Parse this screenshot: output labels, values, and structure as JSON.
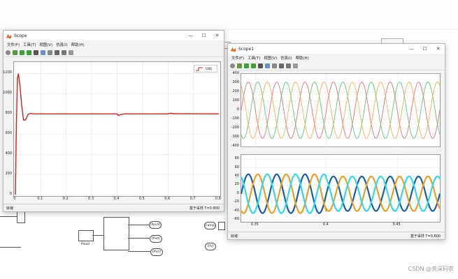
{
  "scope1": {
    "title": "Scope",
    "menu": [
      "文件(F)",
      "工具(T)",
      "视图(V)",
      "仿真(I)",
      "帮助(H)"
    ],
    "status_left": "就绪",
    "status_right": "基于采样  T=0.800",
    "legend": "Udc"
  },
  "scope2": {
    "title": "Scope1",
    "menu": [
      "文件(F)",
      "工具(T)",
      "视图(V)",
      "仿真(I)",
      "帮助(H)"
    ],
    "status_left": "就绪",
    "status_right": "基于采样  T=0.800"
  },
  "window_controls": {
    "minimize": "—",
    "maximize": "☐",
    "close": "✕"
  },
  "model_labels": {
    "pload": "Pload",
    "ppvd": "[Ppvd]",
    "pvd": "[Pvd]",
    "pvd2": "[Pvd]",
    "ramp": "[ramp]",
    "pva": "[Pva]",
    "pv": "[Pv]"
  },
  "watermark": "CSDN @资深码农",
  "chart_data": [
    {
      "type": "line",
      "title": "",
      "xlabel": "",
      "ylabel": "",
      "xlim": [
        0,
        0.8
      ],
      "ylim": [
        0,
        1300
      ],
      "xticks": [
        "0",
        "0.1",
        "0.2",
        "0.3",
        "0.4",
        "0.5",
        "0.6",
        "0.7",
        "0.8"
      ],
      "yticks": [
        "0",
        "200",
        "400",
        "600",
        "800",
        "1000",
        "1200"
      ],
      "legend_position": "top-right",
      "grid": true,
      "series": [
        {
          "name": "Udc",
          "color": "#d11f1f",
          "x": [
            0,
            0.004,
            0.008,
            0.012,
            0.018,
            0.025,
            0.032,
            0.04,
            0.05,
            0.06,
            0.07,
            0.08,
            0.4,
            0.405,
            0.415,
            0.43,
            0.6,
            0.61,
            0.62,
            0.8
          ],
          "y": [
            0,
            700,
            1150,
            1200,
            1080,
            880,
            740,
            740,
            795,
            805,
            800,
            800,
            800,
            785,
            795,
            800,
            800,
            808,
            802,
            800
          ]
        }
      ]
    },
    {
      "type": "line",
      "title": "",
      "xlim": [
        0.34,
        0.48
      ],
      "ylim": [
        -400,
        400
      ],
      "yticks": [
        "400",
        "300",
        "200",
        "100",
        "0",
        "-100",
        "-200",
        "-300",
        "-400"
      ],
      "grid": true,
      "series": [
        {
          "name": "",
          "color": "#e06070",
          "amplitude": 310,
          "phase_deg": 0,
          "freq_hz": 50
        },
        {
          "name": "",
          "color": "#4fc26b",
          "amplitude": 310,
          "phase_deg": 120,
          "freq_hz": 50
        },
        {
          "name": "",
          "color": "#f0a94a",
          "amplitude": 310,
          "phase_deg": 240,
          "freq_hz": 50
        }
      ]
    },
    {
      "type": "line",
      "title": "",
      "xlim": [
        0.34,
        0.48
      ],
      "ylim": [
        -65,
        90
      ],
      "xticks": [
        "0.35",
        "0.4",
        "0.45"
      ],
      "yticks": [
        "80",
        "60",
        "40",
        "20",
        "0",
        "-20",
        "-40",
        "-60"
      ],
      "grid": true,
      "series": [
        {
          "name": "",
          "color": "#1a5fa0",
          "amplitude_before": 45,
          "amplitude_after": 40,
          "phase_deg": 0,
          "freq_hz": 50
        },
        {
          "name": "",
          "color": "#e8a020",
          "amplitude_before": 45,
          "amplitude_after": 40,
          "phase_deg": 120,
          "freq_hz": 50
        },
        {
          "name": "",
          "color": "#30d8f0",
          "amplitude_before": 45,
          "amplitude_after": 40,
          "phase_deg": 240,
          "freq_hz": 50
        }
      ],
      "step_time": 0.4
    }
  ]
}
